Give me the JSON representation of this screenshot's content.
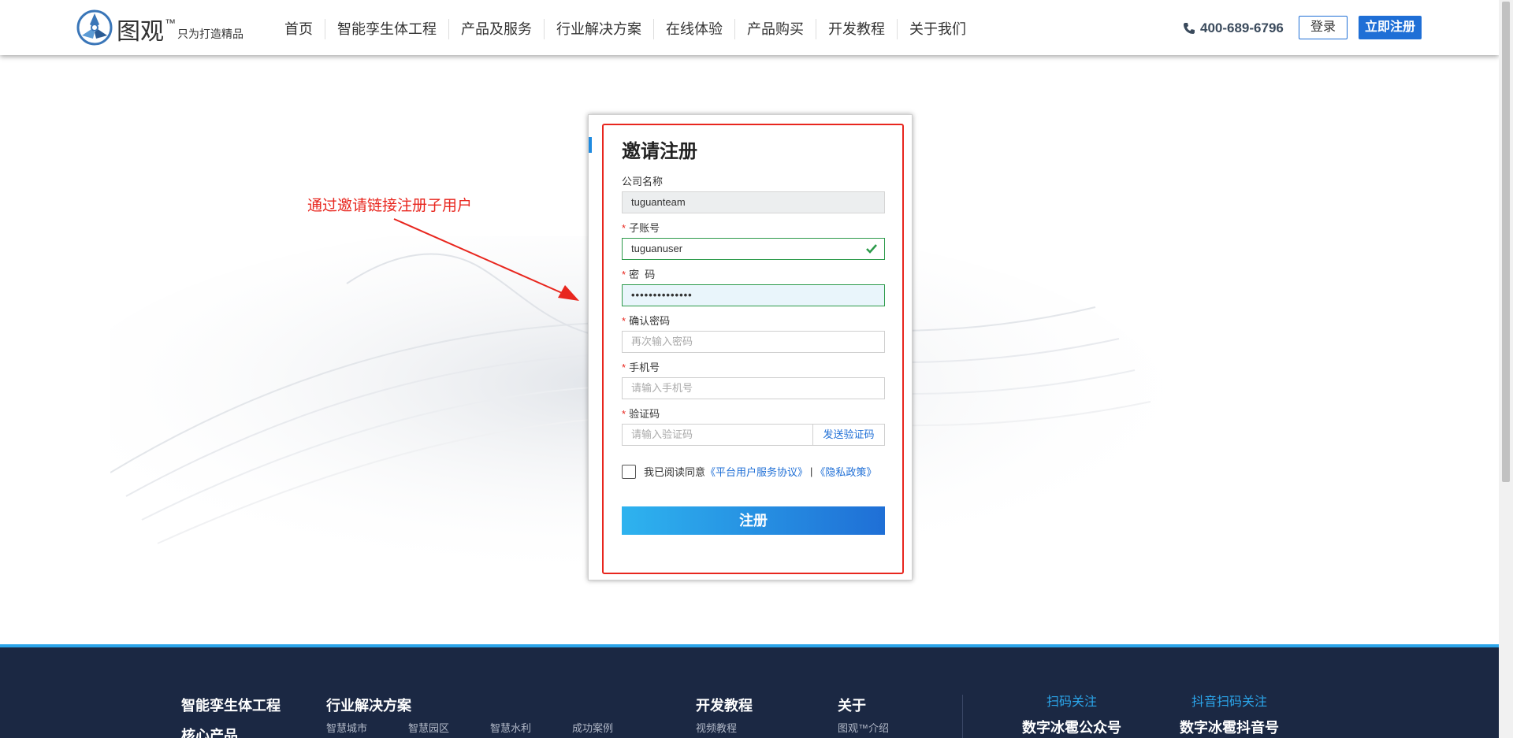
{
  "header": {
    "logo_name": "图观",
    "logo_tm": "™",
    "logo_slogan": "只为打造精品",
    "nav": [
      "首页",
      "智能孪生体工程",
      "产品及服务",
      "行业解决方案",
      "在线体验",
      "产品购买",
      "开发教程",
      "关于我们"
    ],
    "phone": "400-689-6796",
    "login_label": "登录",
    "register_label": "立即注册"
  },
  "annotation": {
    "text": "通过邀请链接注册子用户",
    "color": "#e8261e"
  },
  "form": {
    "title": "邀请注册",
    "company": {
      "label": "公司名称",
      "value": "tuguanteam"
    },
    "account": {
      "label": "子账号",
      "value": "tuguanuser"
    },
    "password": {
      "label": "密  码",
      "value": "••••••••••••••"
    },
    "confirm": {
      "label": "确认密码",
      "placeholder": "再次输入密码"
    },
    "phone": {
      "label": "手机号",
      "placeholder": "请输入手机号"
    },
    "code": {
      "label": "验证码",
      "placeholder": "请输入验证码",
      "send_label": "发送验证码"
    },
    "required_mark": "*",
    "agree": {
      "text": "我已阅读同意",
      "terms": "《平台用户服务协议》",
      "sep": "|",
      "privacy": "《隐私政策》"
    },
    "submit_label": "注册"
  },
  "footer": {
    "col1_title": "智能孪生体工程",
    "col1_sub": "核心产品",
    "col2_title": "行业解决方案",
    "col2_links": [
      "智慧城市",
      "智慧园区",
      "智慧水利",
      "成功案例"
    ],
    "col3_title": "开发教程",
    "col3_links": [
      "视频教程"
    ],
    "col4_title": "关于",
    "col4_links": [
      "图观™介绍"
    ],
    "scan1_title": "扫码关注",
    "scan1_name": "数字冰雹公众号",
    "scan2_title": "抖音扫码关注",
    "scan2_name": "数字冰雹抖音号"
  },
  "colors": {
    "accent": "#1f6fd6",
    "annotation_red": "#e8261e",
    "footer_bg": "#1b2843",
    "valid_green": "#2c9a4a"
  }
}
